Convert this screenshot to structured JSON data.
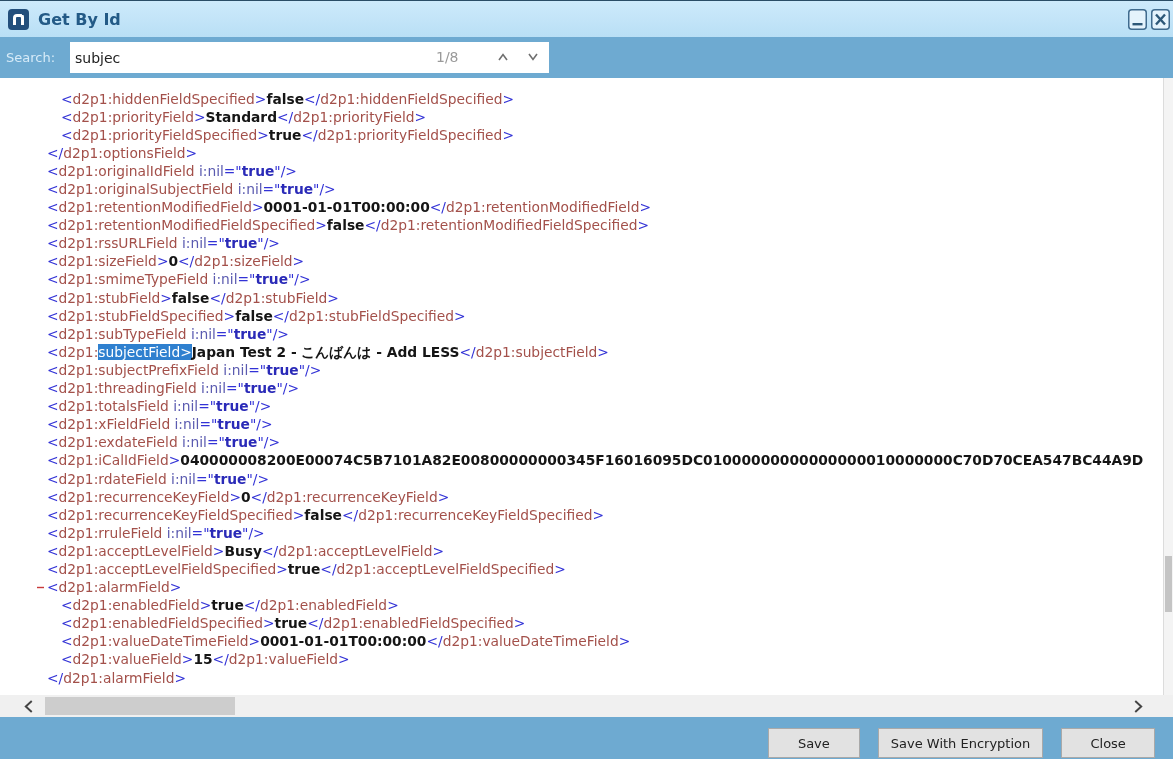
{
  "window": {
    "title": "Get By Id"
  },
  "search": {
    "label": "Search:",
    "value": "subjec",
    "match_count": "1/8"
  },
  "xml": {
    "nodes": [
      {
        "children": [
          {
            "line": [
              {
                "kind": "punct",
                "text": "<"
              },
              {
                "kind": "tag",
                "text": "d2p1:hiddenFieldSpecified"
              },
              {
                "kind": "punct",
                "text": ">"
              },
              {
                "kind": "text",
                "text": "false"
              },
              {
                "kind": "punct",
                "text": "</"
              },
              {
                "kind": "tag",
                "text": "d2p1:hiddenFieldSpecified"
              },
              {
                "kind": "punct",
                "text": ">"
              }
            ]
          },
          {
            "line": [
              {
                "kind": "punct",
                "text": "<"
              },
              {
                "kind": "tag",
                "text": "d2p1:priorityField"
              },
              {
                "kind": "punct",
                "text": ">"
              },
              {
                "kind": "text",
                "text": "Standard"
              },
              {
                "kind": "punct",
                "text": "</"
              },
              {
                "kind": "tag",
                "text": "d2p1:priorityField"
              },
              {
                "kind": "punct",
                "text": ">"
              }
            ]
          },
          {
            "line": [
              {
                "kind": "punct",
                "text": "<"
              },
              {
                "kind": "tag",
                "text": "d2p1:priorityFieldSpecified"
              },
              {
                "kind": "punct",
                "text": ">"
              },
              {
                "kind": "text",
                "text": "true"
              },
              {
                "kind": "punct",
                "text": "</"
              },
              {
                "kind": "tag",
                "text": "d2p1:priorityFieldSpecified"
              },
              {
                "kind": "punct",
                "text": ">"
              }
            ]
          }
        ],
        "closing": [
          {
            "kind": "punct",
            "text": "</"
          },
          {
            "kind": "tag",
            "text": "d2p1:optionsField"
          },
          {
            "kind": "punct",
            "text": ">"
          }
        ]
      },
      {
        "line": [
          {
            "kind": "punct",
            "text": "<"
          },
          {
            "kind": "tag",
            "text": "d2p1:originalIdField"
          },
          {
            "kind": "attr",
            "text": " i:nil"
          },
          {
            "kind": "punct",
            "text": "=\""
          },
          {
            "kind": "value",
            "text": "true"
          },
          {
            "kind": "punct",
            "text": "\"/>"
          }
        ]
      },
      {
        "line": [
          {
            "kind": "punct",
            "text": "<"
          },
          {
            "kind": "tag",
            "text": "d2p1:originalSubjectField"
          },
          {
            "kind": "attr",
            "text": " i:nil"
          },
          {
            "kind": "punct",
            "text": "=\""
          },
          {
            "kind": "value",
            "text": "true"
          },
          {
            "kind": "punct",
            "text": "\"/>"
          }
        ]
      },
      {
        "line": [
          {
            "kind": "punct",
            "text": "<"
          },
          {
            "kind": "tag",
            "text": "d2p1:retentionModifiedField"
          },
          {
            "kind": "punct",
            "text": ">"
          },
          {
            "kind": "text",
            "text": "0001-01-01T00:00:00"
          },
          {
            "kind": "punct",
            "text": "</"
          },
          {
            "kind": "tag",
            "text": "d2p1:retentionModifiedField"
          },
          {
            "kind": "punct",
            "text": ">"
          }
        ]
      },
      {
        "line": [
          {
            "kind": "punct",
            "text": "<"
          },
          {
            "kind": "tag",
            "text": "d2p1:retentionModifiedFieldSpecified"
          },
          {
            "kind": "punct",
            "text": ">"
          },
          {
            "kind": "text",
            "text": "false"
          },
          {
            "kind": "punct",
            "text": "</"
          },
          {
            "kind": "tag",
            "text": "d2p1:retentionModifiedFieldSpecified"
          },
          {
            "kind": "punct",
            "text": ">"
          }
        ]
      },
      {
        "line": [
          {
            "kind": "punct",
            "text": "<"
          },
          {
            "kind": "tag",
            "text": "d2p1:rssURLField"
          },
          {
            "kind": "attr",
            "text": " i:nil"
          },
          {
            "kind": "punct",
            "text": "=\""
          },
          {
            "kind": "value",
            "text": "true"
          },
          {
            "kind": "punct",
            "text": "\"/>"
          }
        ]
      },
      {
        "line": [
          {
            "kind": "punct",
            "text": "<"
          },
          {
            "kind": "tag",
            "text": "d2p1:sizeField"
          },
          {
            "kind": "punct",
            "text": ">"
          },
          {
            "kind": "text",
            "text": "0"
          },
          {
            "kind": "punct",
            "text": "</"
          },
          {
            "kind": "tag",
            "text": "d2p1:sizeField"
          },
          {
            "kind": "punct",
            "text": ">"
          }
        ]
      },
      {
        "line": [
          {
            "kind": "punct",
            "text": "<"
          },
          {
            "kind": "tag",
            "text": "d2p1:smimeTypeField"
          },
          {
            "kind": "attr",
            "text": " i:nil"
          },
          {
            "kind": "punct",
            "text": "=\""
          },
          {
            "kind": "value",
            "text": "true"
          },
          {
            "kind": "punct",
            "text": "\"/>"
          }
        ]
      },
      {
        "line": [
          {
            "kind": "punct",
            "text": "<"
          },
          {
            "kind": "tag",
            "text": "d2p1:stubField"
          },
          {
            "kind": "punct",
            "text": ">"
          },
          {
            "kind": "text",
            "text": "false"
          },
          {
            "kind": "punct",
            "text": "</"
          },
          {
            "kind": "tag",
            "text": "d2p1:stubField"
          },
          {
            "kind": "punct",
            "text": ">"
          }
        ]
      },
      {
        "line": [
          {
            "kind": "punct",
            "text": "<"
          },
          {
            "kind": "tag",
            "text": "d2p1:stubFieldSpecified"
          },
          {
            "kind": "punct",
            "text": ">"
          },
          {
            "kind": "text",
            "text": "false"
          },
          {
            "kind": "punct",
            "text": "</"
          },
          {
            "kind": "tag",
            "text": "d2p1:stubFieldSpecified"
          },
          {
            "kind": "punct",
            "text": ">"
          }
        ]
      },
      {
        "line": [
          {
            "kind": "punct",
            "text": "<"
          },
          {
            "kind": "tag",
            "text": "d2p1:subTypeField"
          },
          {
            "kind": "attr",
            "text": " i:nil"
          },
          {
            "kind": "punct",
            "text": "=\""
          },
          {
            "kind": "value",
            "text": "true"
          },
          {
            "kind": "punct",
            "text": "\"/>"
          }
        ]
      },
      {
        "line": [
          {
            "kind": "punct",
            "text": "<"
          },
          {
            "kind": "tag",
            "text": "d2p1:"
          },
          {
            "kind": "match",
            "text": "subjectField>"
          },
          {
            "kind": "text",
            "text": "Japan Test 2 - こんばんは - Add LESS"
          },
          {
            "kind": "punct",
            "text": "</"
          },
          {
            "kind": "tag",
            "text": "d2p1:subjectField"
          },
          {
            "kind": "punct",
            "text": ">"
          }
        ]
      },
      {
        "line": [
          {
            "kind": "punct",
            "text": "<"
          },
          {
            "kind": "tag",
            "text": "d2p1:subjectPrefixField"
          },
          {
            "kind": "attr",
            "text": " i:nil"
          },
          {
            "kind": "punct",
            "text": "=\""
          },
          {
            "kind": "value",
            "text": "true"
          },
          {
            "kind": "punct",
            "text": "\"/>"
          }
        ]
      },
      {
        "line": [
          {
            "kind": "punct",
            "text": "<"
          },
          {
            "kind": "tag",
            "text": "d2p1:threadingField"
          },
          {
            "kind": "attr",
            "text": " i:nil"
          },
          {
            "kind": "punct",
            "text": "=\""
          },
          {
            "kind": "value",
            "text": "true"
          },
          {
            "kind": "punct",
            "text": "\"/>"
          }
        ]
      },
      {
        "line": [
          {
            "kind": "punct",
            "text": "<"
          },
          {
            "kind": "tag",
            "text": "d2p1:totalsField"
          },
          {
            "kind": "attr",
            "text": " i:nil"
          },
          {
            "kind": "punct",
            "text": "=\""
          },
          {
            "kind": "value",
            "text": "true"
          },
          {
            "kind": "punct",
            "text": "\"/>"
          }
        ]
      },
      {
        "line": [
          {
            "kind": "punct",
            "text": "<"
          },
          {
            "kind": "tag",
            "text": "d2p1:xFieldField"
          },
          {
            "kind": "attr",
            "text": " i:nil"
          },
          {
            "kind": "punct",
            "text": "=\""
          },
          {
            "kind": "value",
            "text": "true"
          },
          {
            "kind": "punct",
            "text": "\"/>"
          }
        ]
      },
      {
        "line": [
          {
            "kind": "punct",
            "text": "<"
          },
          {
            "kind": "tag",
            "text": "d2p1:exdateField"
          },
          {
            "kind": "attr",
            "text": " i:nil"
          },
          {
            "kind": "punct",
            "text": "=\""
          },
          {
            "kind": "value",
            "text": "true"
          },
          {
            "kind": "punct",
            "text": "\"/>"
          }
        ]
      },
      {
        "line": [
          {
            "kind": "punct",
            "text": "<"
          },
          {
            "kind": "tag",
            "text": "d2p1:iCalIdField"
          },
          {
            "kind": "punct",
            "text": ">"
          },
          {
            "kind": "text",
            "text": "040000008200E00074C5B7101A82E00800000000345F16016095DC01000000000000000010000000C70D70CEA547BC44A9D"
          }
        ]
      },
      {
        "line": [
          {
            "kind": "punct",
            "text": "<"
          },
          {
            "kind": "tag",
            "text": "d2p1:rdateField"
          },
          {
            "kind": "attr",
            "text": " i:nil"
          },
          {
            "kind": "punct",
            "text": "=\""
          },
          {
            "kind": "value",
            "text": "true"
          },
          {
            "kind": "punct",
            "text": "\"/>"
          }
        ]
      },
      {
        "line": [
          {
            "kind": "punct",
            "text": "<"
          },
          {
            "kind": "tag",
            "text": "d2p1:recurrenceKeyField"
          },
          {
            "kind": "punct",
            "text": ">"
          },
          {
            "kind": "text",
            "text": "0"
          },
          {
            "kind": "punct",
            "text": "</"
          },
          {
            "kind": "tag",
            "text": "d2p1:recurrenceKeyField"
          },
          {
            "kind": "punct",
            "text": ">"
          }
        ]
      },
      {
        "line": [
          {
            "kind": "punct",
            "text": "<"
          },
          {
            "kind": "tag",
            "text": "d2p1:recurrenceKeyFieldSpecified"
          },
          {
            "kind": "punct",
            "text": ">"
          },
          {
            "kind": "text",
            "text": "false"
          },
          {
            "kind": "punct",
            "text": "</"
          },
          {
            "kind": "tag",
            "text": "d2p1:recurrenceKeyFieldSpecified"
          },
          {
            "kind": "punct",
            "text": ">"
          }
        ]
      },
      {
        "line": [
          {
            "kind": "punct",
            "text": "<"
          },
          {
            "kind": "tag",
            "text": "d2p1:rruleField"
          },
          {
            "kind": "attr",
            "text": " i:nil"
          },
          {
            "kind": "punct",
            "text": "=\""
          },
          {
            "kind": "value",
            "text": "true"
          },
          {
            "kind": "punct",
            "text": "\"/>"
          }
        ]
      },
      {
        "line": [
          {
            "kind": "punct",
            "text": "<"
          },
          {
            "kind": "tag",
            "text": "d2p1:acceptLevelField"
          },
          {
            "kind": "punct",
            "text": ">"
          },
          {
            "kind": "text",
            "text": "Busy"
          },
          {
            "kind": "punct",
            "text": "</"
          },
          {
            "kind": "tag",
            "text": "d2p1:acceptLevelField"
          },
          {
            "kind": "punct",
            "text": ">"
          }
        ]
      },
      {
        "line": [
          {
            "kind": "punct",
            "text": "<"
          },
          {
            "kind": "tag",
            "text": "d2p1:acceptLevelFieldSpecified"
          },
          {
            "kind": "punct",
            "text": ">"
          },
          {
            "kind": "text",
            "text": "true"
          },
          {
            "kind": "punct",
            "text": "</"
          },
          {
            "kind": "tag",
            "text": "d2p1:acceptLevelFieldSpecified"
          },
          {
            "kind": "punct",
            "text": ">"
          }
        ]
      },
      {
        "line": [
          {
            "kind": "punct",
            "text": "<"
          },
          {
            "kind": "tag",
            "text": "d2p1:alarmField"
          },
          {
            "kind": "punct",
            "text": ">"
          }
        ],
        "expanded": true,
        "children": [
          {
            "line": [
              {
                "kind": "punct",
                "text": "<"
              },
              {
                "kind": "tag",
                "text": "d2p1:enabledField"
              },
              {
                "kind": "punct",
                "text": ">"
              },
              {
                "kind": "text",
                "text": "true"
              },
              {
                "kind": "punct",
                "text": "</"
              },
              {
                "kind": "tag",
                "text": "d2p1:enabledField"
              },
              {
                "kind": "punct",
                "text": ">"
              }
            ]
          },
          {
            "line": [
              {
                "kind": "punct",
                "text": "<"
              },
              {
                "kind": "tag",
                "text": "d2p1:enabledFieldSpecified"
              },
              {
                "kind": "punct",
                "text": ">"
              },
              {
                "kind": "text",
                "text": "true"
              },
              {
                "kind": "punct",
                "text": "</"
              },
              {
                "kind": "tag",
                "text": "d2p1:enabledFieldSpecified"
              },
              {
                "kind": "punct",
                "text": ">"
              }
            ]
          },
          {
            "line": [
              {
                "kind": "punct",
                "text": "<"
              },
              {
                "kind": "tag",
                "text": "d2p1:valueDateTimeField"
              },
              {
                "kind": "punct",
                "text": ">"
              },
              {
                "kind": "text",
                "text": "0001-01-01T00:00:00"
              },
              {
                "kind": "punct",
                "text": "</"
              },
              {
                "kind": "tag",
                "text": "d2p1:valueDateTimeField"
              },
              {
                "kind": "punct",
                "text": ">"
              }
            ]
          },
          {
            "line": [
              {
                "kind": "punct",
                "text": "<"
              },
              {
                "kind": "tag",
                "text": "d2p1:valueField"
              },
              {
                "kind": "punct",
                "text": ">"
              },
              {
                "kind": "text",
                "text": "15"
              },
              {
                "kind": "punct",
                "text": "</"
              },
              {
                "kind": "tag",
                "text": "d2p1:valueField"
              },
              {
                "kind": "punct",
                "text": ">"
              }
            ]
          }
        ],
        "closing": [
          {
            "kind": "punct",
            "text": "</"
          },
          {
            "kind": "tag",
            "text": "d2p1:alarmField"
          },
          {
            "kind": "punct",
            "text": ">"
          }
        ]
      }
    ]
  },
  "buttons": [
    {
      "label": "Save"
    },
    {
      "label": "Save With Encryption"
    },
    {
      "label": "Close"
    }
  ]
}
